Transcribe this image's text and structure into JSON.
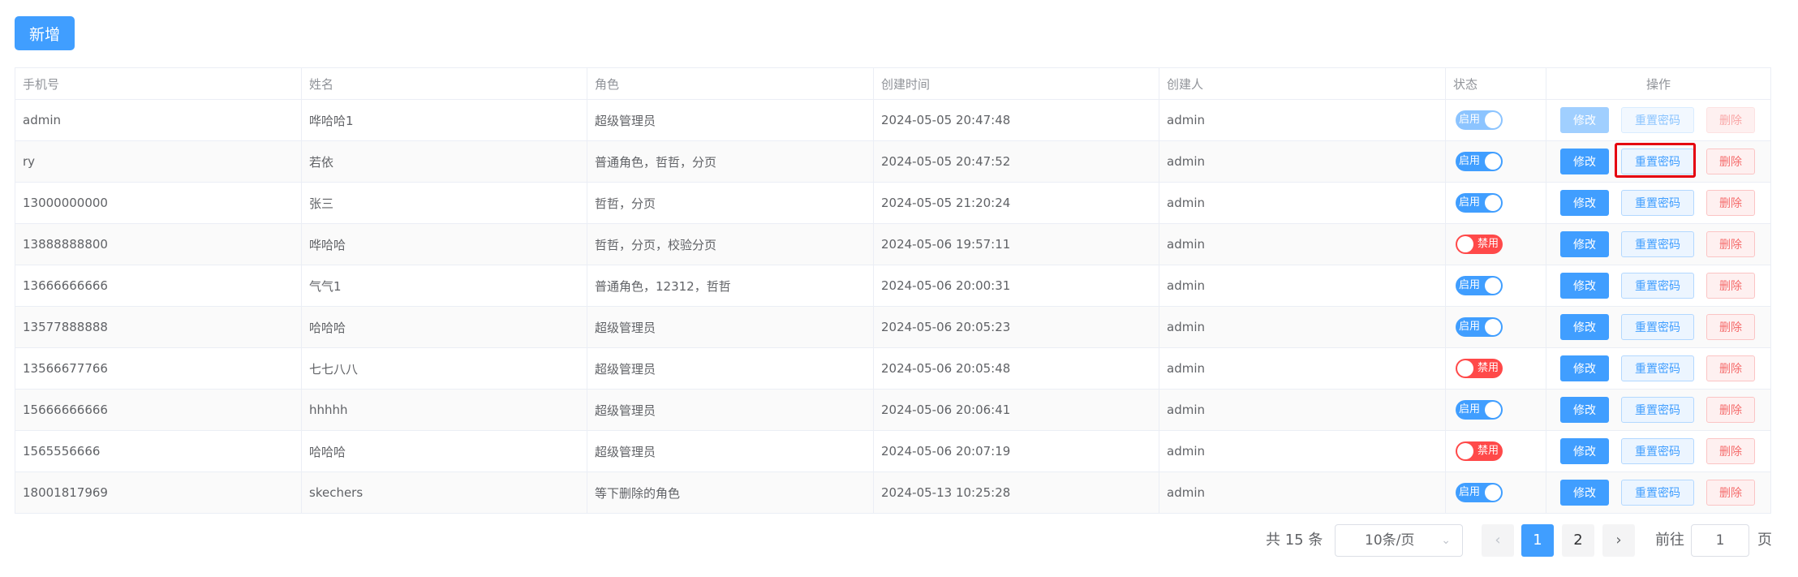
{
  "toolbar": {
    "add_label": "新增"
  },
  "table": {
    "columns": {
      "phone": "手机号",
      "name": "姓名",
      "role": "角色",
      "created_at": "创建时间",
      "creator": "创建人",
      "status": "状态",
      "actions": "操作"
    },
    "action_labels": {
      "edit": "修改",
      "reset_password": "重置密码",
      "delete": "删除"
    },
    "status_labels": {
      "on": "启用",
      "off": "禁用"
    },
    "rows": [
      {
        "phone": "admin",
        "name": "哗哈哈1",
        "role": "超级管理员",
        "created_at": "2024-05-05 20:47:48",
        "creator": "admin",
        "enabled": true,
        "actions_disabled": true
      },
      {
        "phone": "ry",
        "name": "若依",
        "role": "普通角色，哲哲，分页",
        "created_at": "2024-05-05 20:47:52",
        "creator": "admin",
        "enabled": true,
        "actions_disabled": false
      },
      {
        "phone": "13000000000",
        "name": "张三",
        "role": "哲哲，分页",
        "created_at": "2024-05-05 21:20:24",
        "creator": "admin",
        "enabled": true,
        "actions_disabled": false
      },
      {
        "phone": "13888888800",
        "name": "哗哈哈",
        "role": "哲哲，分页，校验分页",
        "created_at": "2024-05-06 19:57:11",
        "creator": "admin",
        "enabled": false,
        "actions_disabled": false
      },
      {
        "phone": "13666666666",
        "name": "气气1",
        "role": "普通角色，12312，哲哲",
        "created_at": "2024-05-06 20:00:31",
        "creator": "admin",
        "enabled": true,
        "actions_disabled": false
      },
      {
        "phone": "13577888888",
        "name": "哈哈哈",
        "role": "超级管理员",
        "created_at": "2024-05-06 20:05:23",
        "creator": "admin",
        "enabled": true,
        "actions_disabled": false
      },
      {
        "phone": "13566677766",
        "name": "七七八八",
        "role": "超级管理员",
        "created_at": "2024-05-06 20:05:48",
        "creator": "admin",
        "enabled": false,
        "actions_disabled": false
      },
      {
        "phone": "15666666666",
        "name": "hhhhh",
        "role": "超级管理员",
        "created_at": "2024-05-06 20:06:41",
        "creator": "admin",
        "enabled": true,
        "actions_disabled": false
      },
      {
        "phone": "1565556666",
        "name": "哈哈哈",
        "role": "超级管理员",
        "created_at": "2024-05-06 20:07:19",
        "creator": "admin",
        "enabled": false,
        "actions_disabled": false
      },
      {
        "phone": "18001817969",
        "name": "skechers",
        "role": "等下删除的角色",
        "created_at": "2024-05-13 10:25:28",
        "creator": "admin",
        "enabled": true,
        "actions_disabled": false
      }
    ]
  },
  "pagination": {
    "total_text": "共 15 条",
    "page_size": "10条/页",
    "pages": [
      "1",
      "2"
    ],
    "current_page": "1",
    "goto_label": "前往",
    "goto_value": "1",
    "page_suffix": "页"
  },
  "colors": {
    "primary": "#409eff",
    "danger": "#f56c6c",
    "switch_off": "#ff4949",
    "highlight": "#e5000f"
  },
  "icons": {
    "prev": "chevron-left-icon",
    "next": "chevron-right-icon",
    "dropdown": "chevron-down-icon"
  }
}
